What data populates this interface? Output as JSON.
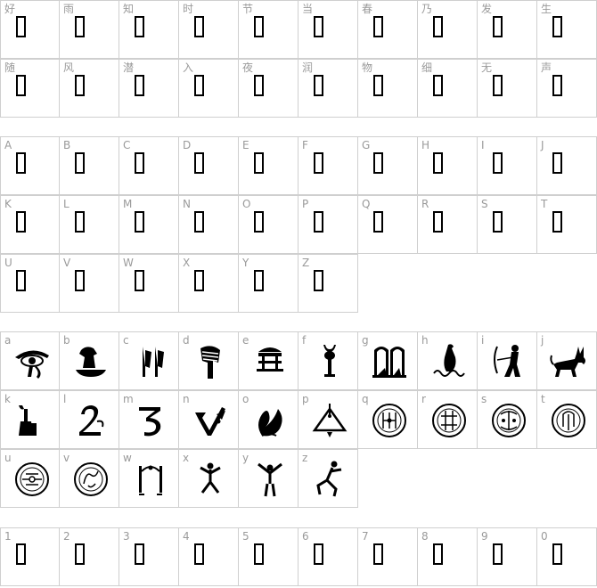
{
  "sections": {
    "chinese": [
      "好",
      "雨",
      "知",
      "时",
      "节",
      "当",
      "春",
      "乃",
      "发",
      "生",
      "随",
      "风",
      "潜",
      "入",
      "夜",
      "润",
      "物",
      "细",
      "无",
      "声"
    ],
    "uppercase": [
      "A",
      "B",
      "C",
      "D",
      "E",
      "F",
      "G",
      "H",
      "I",
      "J",
      "K",
      "L",
      "M",
      "N",
      "O",
      "P",
      "Q",
      "R",
      "S",
      "T",
      "U",
      "V",
      "W",
      "X",
      "Y",
      "Z"
    ],
    "lowercase": [
      "a",
      "b",
      "c",
      "d",
      "e",
      "f",
      "g",
      "h",
      "i",
      "j",
      "k",
      "l",
      "m",
      "n",
      "o",
      "p",
      "q",
      "r",
      "s",
      "t",
      "u",
      "v",
      "w",
      "x",
      "y",
      "z"
    ],
    "digits": [
      "1",
      "2",
      "3",
      "4",
      "5",
      "6",
      "7",
      "8",
      "9",
      "0"
    ]
  },
  "lowercase_glyphs": [
    "eye-of-horus-icon",
    "bird-on-boat-icon",
    "standard-flags-icon",
    "pharaoh-head-icon",
    "shrine-table-icon",
    "ankh-altar-icon",
    "temple-gate-icon",
    "falcon-tree-icon",
    "archer-figure-icon",
    "jackal-icon",
    "seated-figure-icon",
    "sigil-2-icon",
    "sigil-3-icon",
    "sigil-arrow-icon",
    "sigil-leaf-icon",
    "sigil-triangle-icon",
    "circle-seal-1-icon",
    "circle-seal-2-icon",
    "circle-seal-3-icon",
    "circle-seal-4-icon",
    "circle-seal-5-icon",
    "circle-seal-6-icon",
    "dancer-a-icon",
    "dancer-b-icon",
    "dancer-c-icon",
    "dancer-d-icon"
  ]
}
